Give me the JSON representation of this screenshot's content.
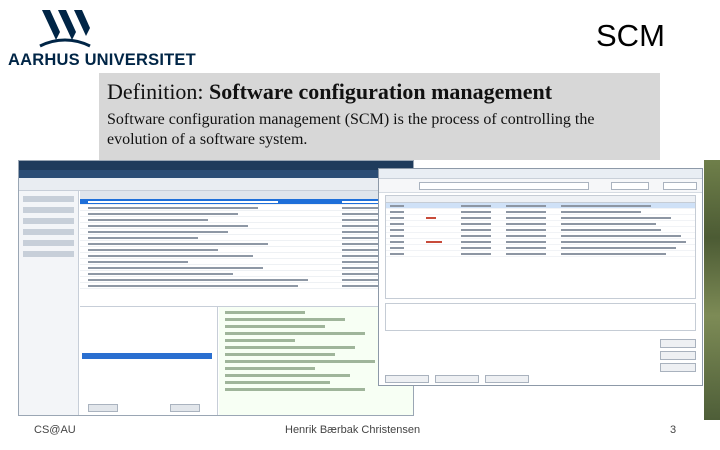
{
  "header": {
    "logo_text": "AARHUS UNIVERSITET",
    "slide_title": "SCM"
  },
  "definition": {
    "title_prefix": "Definition: ",
    "title_bold": "Software configuration management",
    "body": "Software configuration management (SCM) is the process of controlling the evolution of a software system."
  },
  "footer": {
    "left": "CS@AU",
    "center": "Henrik Bærbak Christensen",
    "page_number": "3"
  },
  "colors": {
    "brand": "#002546",
    "definition_background": "#d7d7d7"
  }
}
